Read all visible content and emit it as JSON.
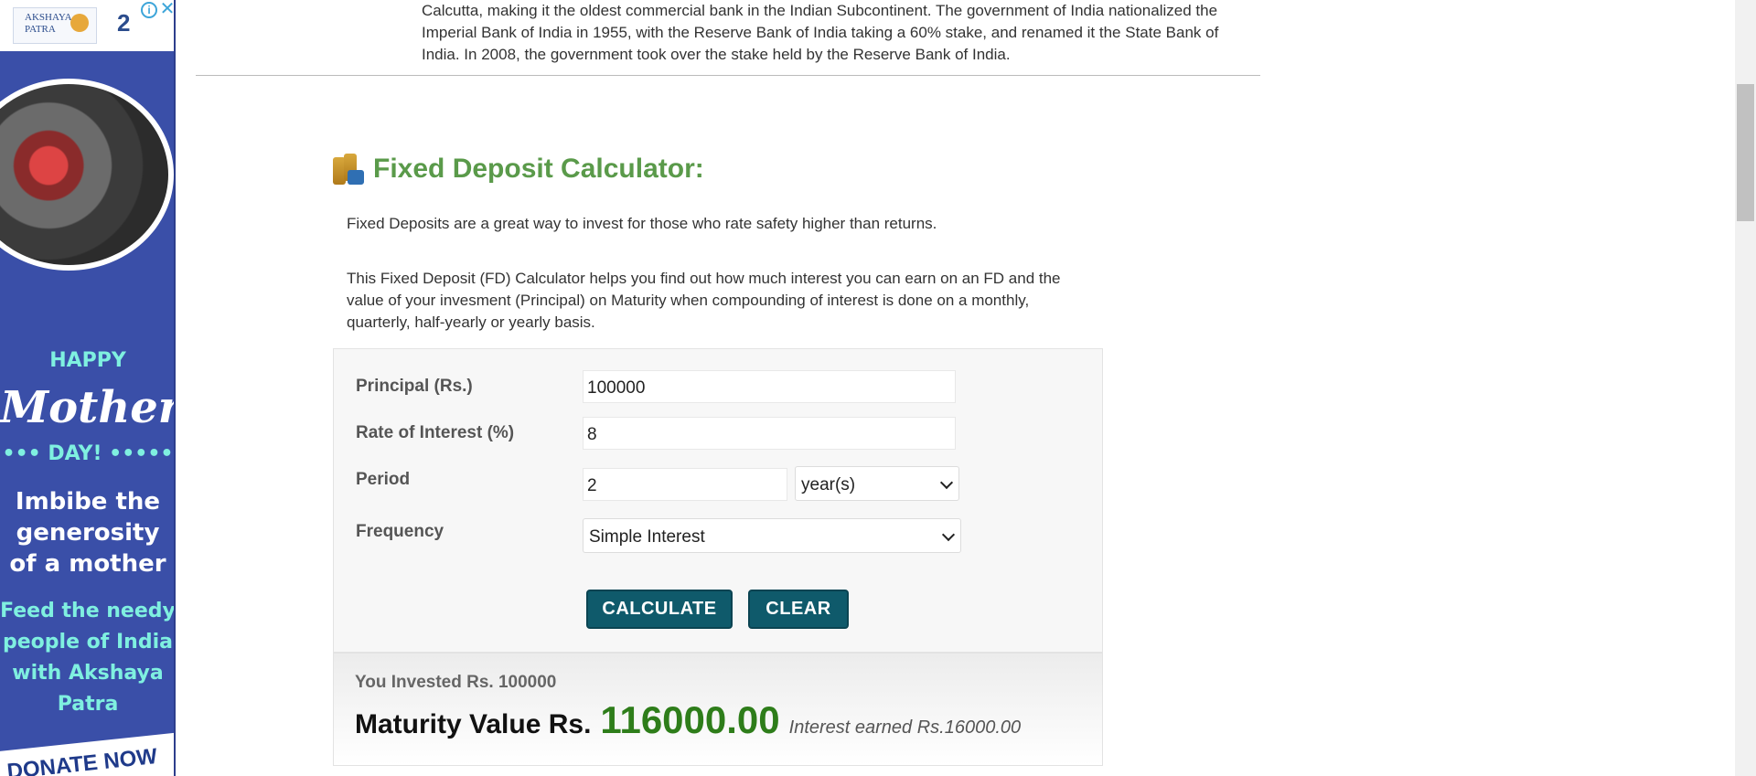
{
  "ad": {
    "brand1": "AKSHAYA PATRA",
    "happy": "HAPPY",
    "mothers": "Mother's",
    "day": "••• DAY! •••••",
    "imbibe": "Imbibe the generosity of a mother",
    "feed": "Feed the needy people of India with Akshaya Patra",
    "donate": "DONATE NOW",
    "info_icon": "info-icon",
    "close_icon": "close-icon"
  },
  "intro_text": "Calcutta, making it the oldest commercial bank in the Indian Subcontinent. The government of India nationalized the Imperial Bank of India in 1955, with the Reserve Bank of India taking a 60% stake, and renamed it the State Bank of India. In 2008, the government took over the stake held by the Reserve Bank of India.",
  "calculator": {
    "title": "Fixed Deposit Calculator:",
    "icon": "coins-icon",
    "para1": "Fixed Deposits are a great way to invest for those who rate safety higher than returns.",
    "para2": "This Fixed Deposit (FD) Calculator helps you find out how much interest you can earn on an FD and the value of your invesment (Principal) on Maturity when compounding of interest is done on a monthly, quarterly, half-yearly or yearly basis.",
    "principal_label": "Principal (Rs.)",
    "principal_value": "100000",
    "rate_label": "Rate of Interest (%)",
    "rate_value": "8",
    "period_label": "Period",
    "period_value": "2",
    "period_unit": "year(s)",
    "frequency_label": "Frequency",
    "frequency_value": "Simple Interest",
    "calculate_label": "CALCULATE",
    "clear_label": "CLEAR"
  },
  "result": {
    "invested": "You Invested Rs. 100000",
    "maturity_label": "Maturity Value Rs.",
    "maturity_value": "116000.00",
    "interest_earned": "Interest earned Rs.16000.00"
  },
  "colors": {
    "title_green": "#5a9a4a",
    "button_teal": "#0f5a6b",
    "maturity_green": "#2e7d1a",
    "ad_blue": "#3a4fa8"
  }
}
